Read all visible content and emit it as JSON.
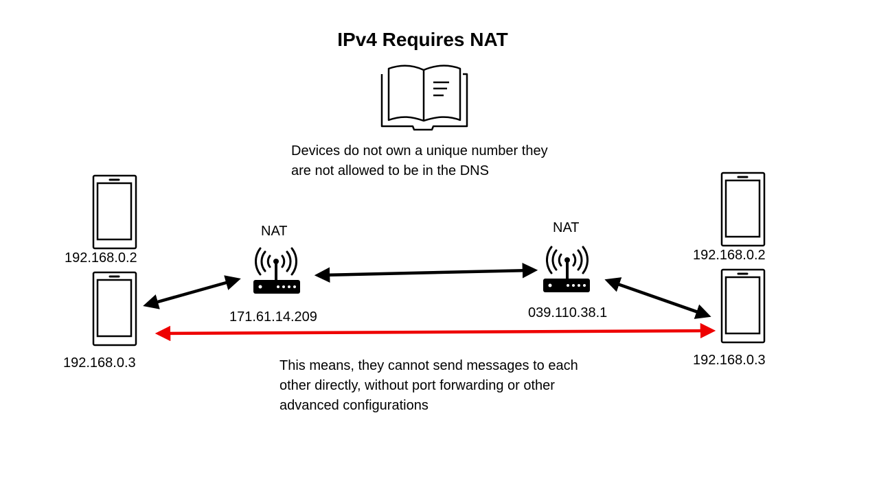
{
  "title": "IPv4 Requires NAT",
  "top_note": {
    "line1": "Devices do not own a unique number they",
    "line2": "are not allowed to be in the DNS"
  },
  "bottom_note": {
    "line1": "This means, they cannot send messages to each",
    "line2": "other directly, without port forwarding or other",
    "line3": "advanced configurations"
  },
  "left_network": {
    "nat_label": "NAT",
    "public_ip": "171.61.14.209",
    "device_top_ip": "192.168.0.2",
    "device_bottom_ip": "192.168.0.3"
  },
  "right_network": {
    "nat_label": "NAT",
    "public_ip": "039.110.38.1",
    "device_top_ip": "192.168.0.2",
    "device_bottom_ip": "192.168.0.3"
  },
  "icons": {
    "book": "book-icon",
    "router": "router-icon",
    "phone": "phone-icon"
  },
  "colors": {
    "line": "#000000",
    "blocked_link": "#ee0000"
  }
}
